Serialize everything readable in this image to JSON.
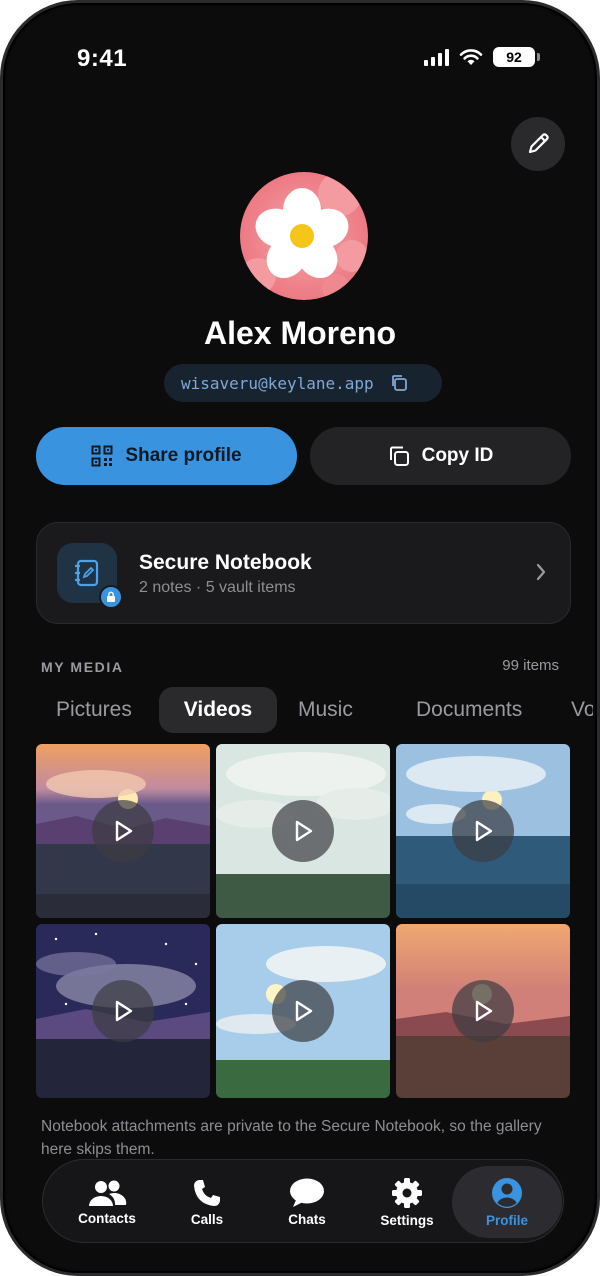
{
  "status": {
    "time": "9:41",
    "battery": "92"
  },
  "profile": {
    "name": "Alex Moreno",
    "id": "wisaveru@keylane.app",
    "share_label": "Share profile",
    "copy_label": "Copy ID"
  },
  "notebook": {
    "title": "Secure Notebook",
    "subtitle": "2 notes · 5 vault items"
  },
  "media": {
    "section_label": "MY MEDIA",
    "count": "99 items",
    "tabs": [
      {
        "label": "Pictures"
      },
      {
        "label": "Videos"
      },
      {
        "label": "Music"
      },
      {
        "label": "Documents"
      },
      {
        "label": "Vo"
      }
    ],
    "active_tab": "Videos",
    "note": "Notebook attachments are private to the Secure Notebook, so the gallery here skips them."
  },
  "tabbar": {
    "items": [
      {
        "label": "Contacts",
        "icon": "contacts-icon"
      },
      {
        "label": "Calls",
        "icon": "phone-icon"
      },
      {
        "label": "Chats",
        "icon": "chat-bubble-icon"
      },
      {
        "label": "Settings",
        "icon": "gear-icon"
      },
      {
        "label": "Profile",
        "icon": "profile-icon"
      }
    ],
    "active": "Profile"
  },
  "colors": {
    "accent": "#3a93de",
    "background": "#0c0c0d"
  }
}
